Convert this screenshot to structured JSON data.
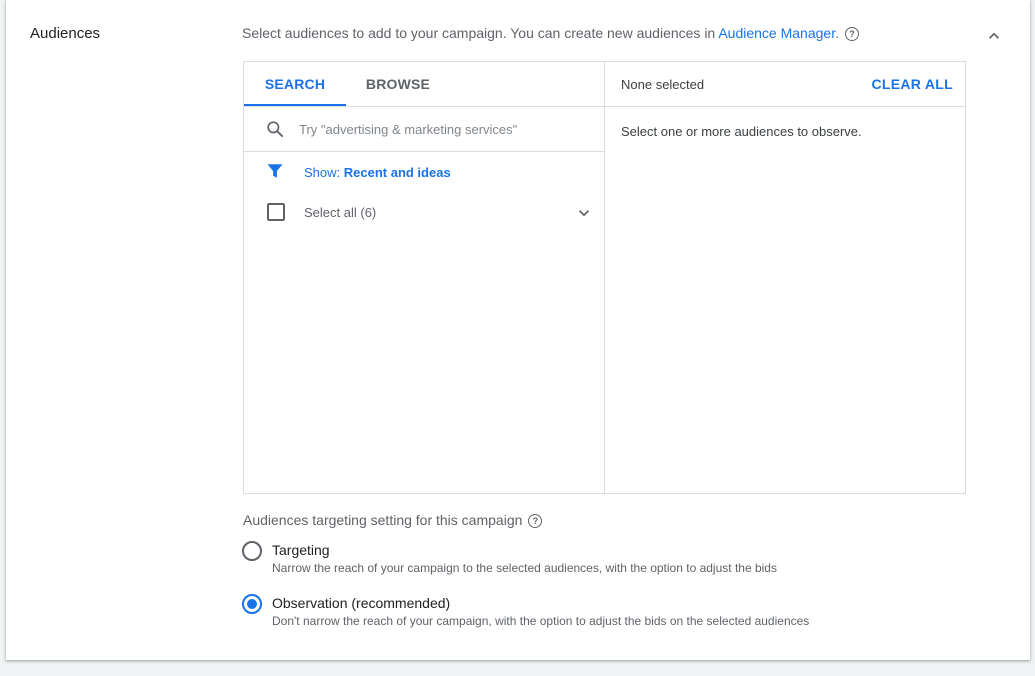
{
  "section": {
    "title": "Audiences",
    "intro_text": "Select audiences to add to your campaign. You can create new audiences in ",
    "intro_link": "Audience Manager",
    "intro_end": "."
  },
  "picker": {
    "tabs": [
      {
        "label": "SEARCH",
        "active": true
      },
      {
        "label": "BROWSE",
        "active": false
      }
    ],
    "search": {
      "value": "",
      "placeholder": "Try \"advertising & marketing services\""
    },
    "filter": {
      "label": "Show: ",
      "value": "Recent and ideas"
    },
    "select_all_label": "Select all (6)",
    "selected_header": "None selected",
    "clear_all_label": "CLEAR ALL",
    "empty_hint": "Select one or more audiences to observe."
  },
  "targeting": {
    "title": "Audiences targeting setting for this campaign",
    "options": [
      {
        "label": "Targeting",
        "description": "Narrow the reach of your campaign to the selected audiences, with the option to adjust the bids",
        "selected": false
      },
      {
        "label": "Observation (recommended)",
        "description": "Don't narrow the reach of your campaign, with the option to adjust the bids on the selected audiences",
        "selected": true
      }
    ]
  },
  "icons": {
    "help": "help-circle-icon",
    "collapse": "chevron-up-icon",
    "search": "search-icon",
    "filter": "filter-icon",
    "expand": "chevron-down-icon"
  },
  "colors": {
    "accent": "#1a73e8",
    "text": "#3c4043",
    "muted": "#5f6368",
    "border": "#dadce0"
  }
}
